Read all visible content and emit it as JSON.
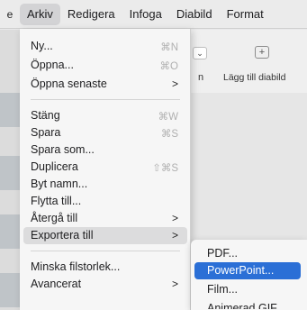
{
  "menubar": {
    "edge_glyph": "e",
    "items": [
      "Arkiv",
      "Redigera",
      "Infoga",
      "Diabild",
      "Format"
    ],
    "active_index": 0
  },
  "toolbar": {
    "dropdown_glyph": "⌄",
    "n_label": "n",
    "add_slide_icon": "plus-icon",
    "add_slide_label": "Lägg till diabild"
  },
  "file_menu": {
    "items": [
      {
        "label": "Ny...",
        "shortcut": "⌘N"
      },
      {
        "label": "Öppna...",
        "shortcut": "⌘O"
      },
      {
        "label": "Öppna senaste",
        "submenu": true
      },
      {
        "label": "Stäng",
        "shortcut": "⌘W"
      },
      {
        "label": "Spara",
        "shortcut": "⌘S"
      },
      {
        "label": "Spara som..."
      },
      {
        "label": "Duplicera",
        "shortcut": "⇧⌘S"
      },
      {
        "label": "Byt namn..."
      },
      {
        "label": "Flytta till..."
      },
      {
        "label": "Återgå till",
        "submenu": true
      },
      {
        "label": "Exportera till",
        "submenu": true,
        "highlighted": true
      },
      {
        "label": "Minska filstorlek..."
      },
      {
        "label": "Avancerat",
        "submenu": true
      }
    ],
    "submenu_arrow": ">"
  },
  "export_submenu": {
    "items": [
      "PDF...",
      "PowerPoint...",
      "Film...",
      "Animerad GIF..."
    ],
    "selected_index": 1
  },
  "colors": {
    "selection": "#2b6fd6",
    "hover": "#dcdcdd",
    "menu_bg": "#f6f6f6"
  }
}
